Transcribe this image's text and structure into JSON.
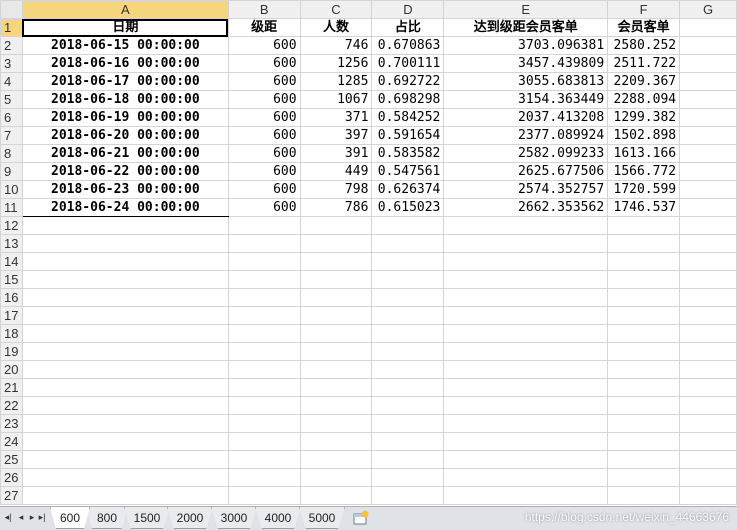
{
  "columns": [
    "A",
    "B",
    "C",
    "D",
    "E",
    "F",
    "G"
  ],
  "rows": [
    "1",
    "2",
    "3",
    "4",
    "5",
    "6",
    "7",
    "8",
    "9",
    "10",
    "11",
    "12",
    "13",
    "14",
    "15",
    "16",
    "17",
    "18",
    "19",
    "20",
    "21",
    "22",
    "23",
    "24",
    "25",
    "26",
    "27"
  ],
  "headers": [
    "日期",
    "级距",
    "人数",
    "占比",
    "达到级距会员客单",
    "会员客单"
  ],
  "data": [
    [
      "2018-06-15 00:00:00",
      "600",
      "746",
      "0.670863",
      "3703.096381",
      "2580.252"
    ],
    [
      "2018-06-16 00:00:00",
      "600",
      "1256",
      "0.700111",
      "3457.439809",
      "2511.722"
    ],
    [
      "2018-06-17 00:00:00",
      "600",
      "1285",
      "0.692722",
      "3055.683813",
      "2209.367"
    ],
    [
      "2018-06-18 00:00:00",
      "600",
      "1067",
      "0.698298",
      "3154.363449",
      "2288.094"
    ],
    [
      "2018-06-19 00:00:00",
      "600",
      "371",
      "0.584252",
      "2037.413208",
      "1299.382"
    ],
    [
      "2018-06-20 00:00:00",
      "600",
      "397",
      "0.591654",
      "2377.089924",
      "1502.898"
    ],
    [
      "2018-06-21 00:00:00",
      "600",
      "391",
      "0.583582",
      "2582.099233",
      "1613.166"
    ],
    [
      "2018-06-22 00:00:00",
      "600",
      "449",
      "0.547561",
      "2625.677506",
      "1566.772"
    ],
    [
      "2018-06-23 00:00:00",
      "600",
      "798",
      "0.626374",
      "2574.352757",
      "1720.599"
    ],
    [
      "2018-06-24 00:00:00",
      "600",
      "786",
      "0.615023",
      "2662.353562",
      "1746.537"
    ]
  ],
  "tabs": [
    "600",
    "800",
    "1500",
    "2000",
    "3000",
    "4000",
    "5000"
  ],
  "active_tab": "600",
  "selected_cell": "A1",
  "colors": {
    "header_bg": "#f0f0f0",
    "selected_header_bg": "#f5d57e",
    "tabbar_bg": "#dfe3e8"
  },
  "watermark": "https://blog.csdn.net/weixin_44663676"
}
